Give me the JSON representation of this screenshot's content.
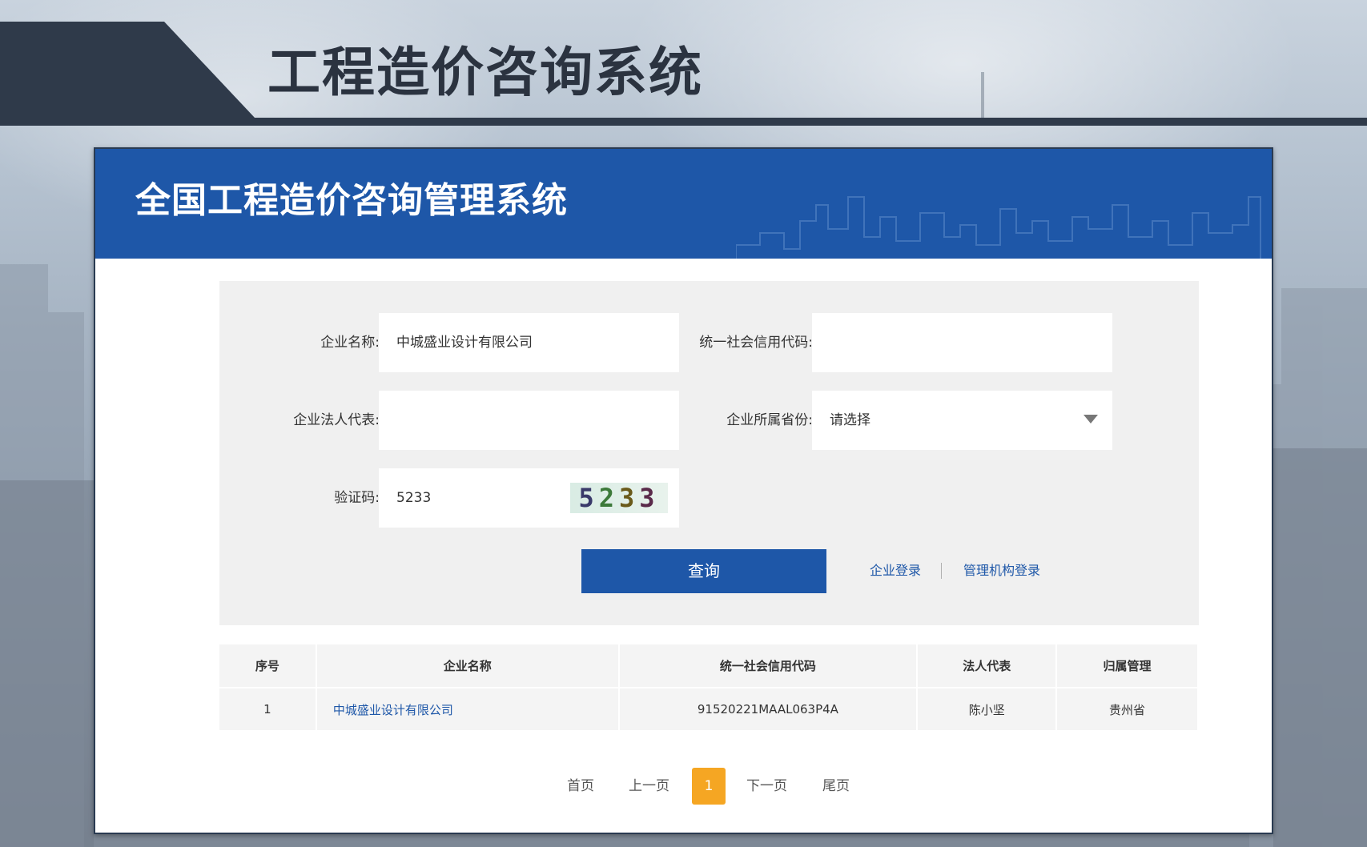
{
  "slide": {
    "title": "工程造价咨询系统"
  },
  "app": {
    "title": "全国工程造价咨询管理系统"
  },
  "search": {
    "company_name_label": "企业名称:",
    "company_name_value": "中城盛业设计有限公司",
    "credit_code_label": "统一社会信用代码:",
    "credit_code_value": "",
    "legal_rep_label": "企业法人代表:",
    "legal_rep_value": "",
    "province_label": "企业所属省份:",
    "province_value": "请选择",
    "captcha_label": "验证码:",
    "captcha_value": "5233",
    "captcha_digits": [
      "5",
      "2",
      "3",
      "3"
    ],
    "query_button": "查询",
    "company_login": "企业登录",
    "admin_login": "管理机构登录"
  },
  "table": {
    "headers": [
      "序号",
      "企业名称",
      "统一社会信用代码",
      "法人代表",
      "归属管理"
    ],
    "rows": [
      [
        "1",
        "中城盛业设计有限公司",
        "91520221MAAL063P4A",
        "陈小坚",
        "贵州省"
      ]
    ]
  },
  "pagination": {
    "first": "首页",
    "prev": "上一页",
    "current": "1",
    "next": "下一页",
    "last": "尾页"
  },
  "colors": {
    "primary_blue": "#1e57a8",
    "header_dark": "#2f3a4a",
    "page_current": "#f5a623"
  }
}
